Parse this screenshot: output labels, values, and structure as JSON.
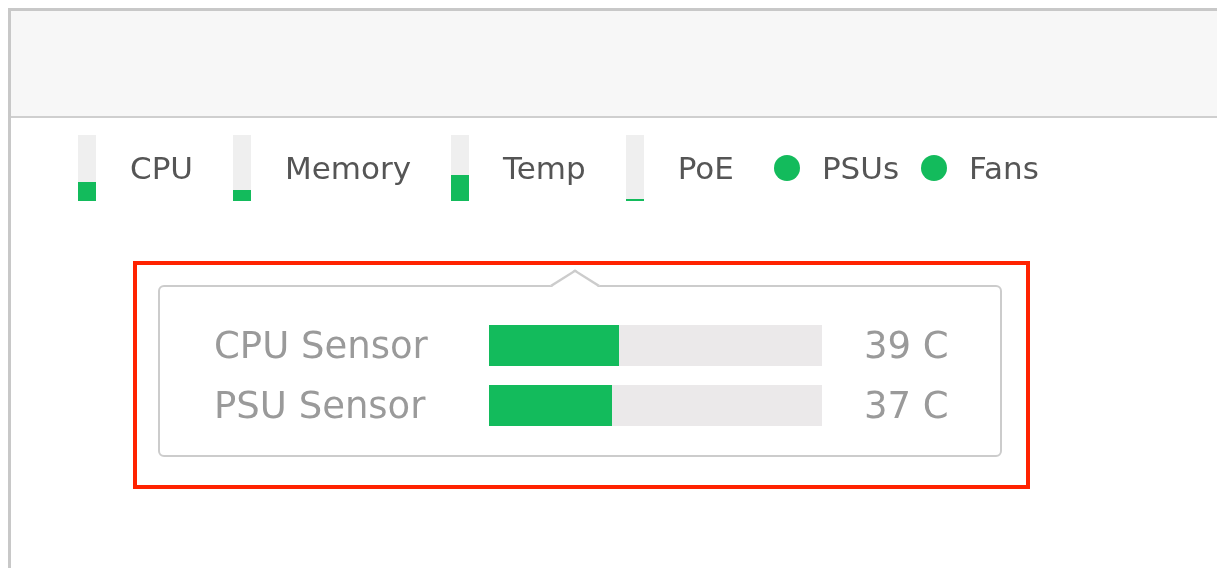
{
  "stats": [
    {
      "kind": "meter",
      "label": "CPU",
      "level": 0.29
    },
    {
      "kind": "meter",
      "label": "Memory",
      "level": 0.17
    },
    {
      "kind": "meter",
      "label": "Temp",
      "level": 0.39
    },
    {
      "kind": "meter",
      "label": "PoE",
      "level": 0.03
    },
    {
      "kind": "status",
      "label": "PSUs",
      "color": "#13bb5c"
    },
    {
      "kind": "status",
      "label": "Fans",
      "color": "#13bb5c"
    }
  ],
  "tooltip": {
    "highlighted": true,
    "rows": [
      {
        "label": "CPU Sensor",
        "level": 0.39,
        "reading": "39 C"
      },
      {
        "label": "PSU Sensor",
        "level": 0.37,
        "reading": "37 C"
      }
    ]
  }
}
